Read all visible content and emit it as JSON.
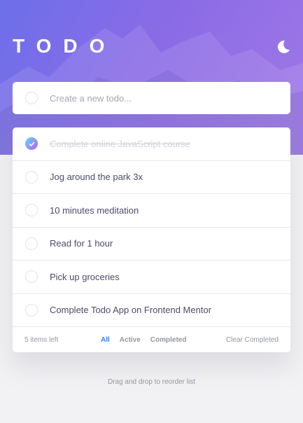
{
  "app": {
    "title": "TODO"
  },
  "theme_icon": "moon-icon",
  "new_todo": {
    "placeholder": "Create a new todo..."
  },
  "todos": [
    {
      "text": "Complete online JavaScript course",
      "completed": true
    },
    {
      "text": "Jog around the park 3x",
      "completed": false
    },
    {
      "text": "10 minutes meditation",
      "completed": false
    },
    {
      "text": "Read for 1 hour",
      "completed": false
    },
    {
      "text": "Pick up groceries",
      "completed": false
    },
    {
      "text": "Complete Todo App on Frontend Mentor",
      "completed": false
    }
  ],
  "footer": {
    "items_left": "5 items left",
    "filters": [
      "All",
      "Active",
      "Completed"
    ],
    "active_filter": "All",
    "clear_label": "Clear Completed"
  },
  "hint": "Drag and drop to reorder list",
  "colors": {
    "accent": "#3a7cfd",
    "check_gradient_start": "#57ddff",
    "check_gradient_end": "#c058f3",
    "hero_start": "#6d6fea",
    "hero_end": "#a078e6"
  }
}
